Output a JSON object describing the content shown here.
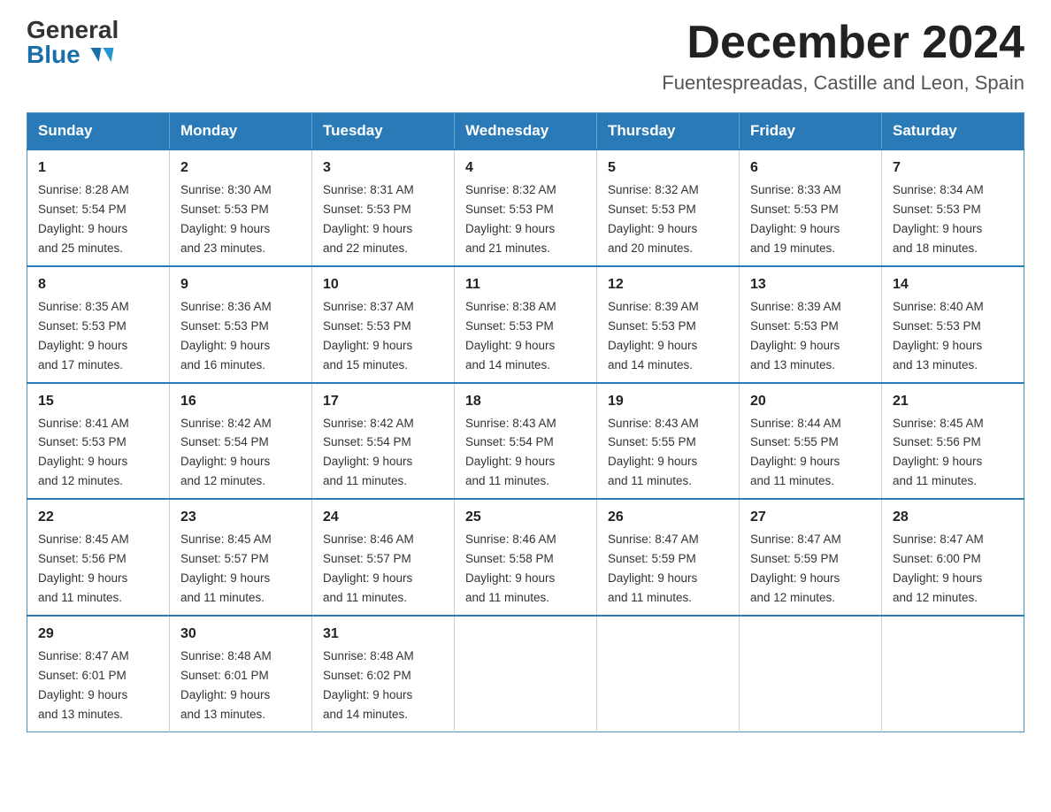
{
  "header": {
    "logo_general": "General",
    "logo_blue": "Blue",
    "month": "December 2024",
    "location": "Fuentespreadas, Castille and Leon, Spain"
  },
  "weekdays": [
    "Sunday",
    "Monday",
    "Tuesday",
    "Wednesday",
    "Thursday",
    "Friday",
    "Saturday"
  ],
  "weeks": [
    [
      {
        "day": "1",
        "sunrise": "8:28 AM",
        "sunset": "5:54 PM",
        "daylight": "9 hours and 25 minutes."
      },
      {
        "day": "2",
        "sunrise": "8:30 AM",
        "sunset": "5:53 PM",
        "daylight": "9 hours and 23 minutes."
      },
      {
        "day": "3",
        "sunrise": "8:31 AM",
        "sunset": "5:53 PM",
        "daylight": "9 hours and 22 minutes."
      },
      {
        "day": "4",
        "sunrise": "8:32 AM",
        "sunset": "5:53 PM",
        "daylight": "9 hours and 21 minutes."
      },
      {
        "day": "5",
        "sunrise": "8:32 AM",
        "sunset": "5:53 PM",
        "daylight": "9 hours and 20 minutes."
      },
      {
        "day": "6",
        "sunrise": "8:33 AM",
        "sunset": "5:53 PM",
        "daylight": "9 hours and 19 minutes."
      },
      {
        "day": "7",
        "sunrise": "8:34 AM",
        "sunset": "5:53 PM",
        "daylight": "9 hours and 18 minutes."
      }
    ],
    [
      {
        "day": "8",
        "sunrise": "8:35 AM",
        "sunset": "5:53 PM",
        "daylight": "9 hours and 17 minutes."
      },
      {
        "day": "9",
        "sunrise": "8:36 AM",
        "sunset": "5:53 PM",
        "daylight": "9 hours and 16 minutes."
      },
      {
        "day": "10",
        "sunrise": "8:37 AM",
        "sunset": "5:53 PM",
        "daylight": "9 hours and 15 minutes."
      },
      {
        "day": "11",
        "sunrise": "8:38 AM",
        "sunset": "5:53 PM",
        "daylight": "9 hours and 14 minutes."
      },
      {
        "day": "12",
        "sunrise": "8:39 AM",
        "sunset": "5:53 PM",
        "daylight": "9 hours and 14 minutes."
      },
      {
        "day": "13",
        "sunrise": "8:39 AM",
        "sunset": "5:53 PM",
        "daylight": "9 hours and 13 minutes."
      },
      {
        "day": "14",
        "sunrise": "8:40 AM",
        "sunset": "5:53 PM",
        "daylight": "9 hours and 13 minutes."
      }
    ],
    [
      {
        "day": "15",
        "sunrise": "8:41 AM",
        "sunset": "5:53 PM",
        "daylight": "9 hours and 12 minutes."
      },
      {
        "day": "16",
        "sunrise": "8:42 AM",
        "sunset": "5:54 PM",
        "daylight": "9 hours and 12 minutes."
      },
      {
        "day": "17",
        "sunrise": "8:42 AM",
        "sunset": "5:54 PM",
        "daylight": "9 hours and 11 minutes."
      },
      {
        "day": "18",
        "sunrise": "8:43 AM",
        "sunset": "5:54 PM",
        "daylight": "9 hours and 11 minutes."
      },
      {
        "day": "19",
        "sunrise": "8:43 AM",
        "sunset": "5:55 PM",
        "daylight": "9 hours and 11 minutes."
      },
      {
        "day": "20",
        "sunrise": "8:44 AM",
        "sunset": "5:55 PM",
        "daylight": "9 hours and 11 minutes."
      },
      {
        "day": "21",
        "sunrise": "8:45 AM",
        "sunset": "5:56 PM",
        "daylight": "9 hours and 11 minutes."
      }
    ],
    [
      {
        "day": "22",
        "sunrise": "8:45 AM",
        "sunset": "5:56 PM",
        "daylight": "9 hours and 11 minutes."
      },
      {
        "day": "23",
        "sunrise": "8:45 AM",
        "sunset": "5:57 PM",
        "daylight": "9 hours and 11 minutes."
      },
      {
        "day": "24",
        "sunrise": "8:46 AM",
        "sunset": "5:57 PM",
        "daylight": "9 hours and 11 minutes."
      },
      {
        "day": "25",
        "sunrise": "8:46 AM",
        "sunset": "5:58 PM",
        "daylight": "9 hours and 11 minutes."
      },
      {
        "day": "26",
        "sunrise": "8:47 AM",
        "sunset": "5:59 PM",
        "daylight": "9 hours and 11 minutes."
      },
      {
        "day": "27",
        "sunrise": "8:47 AM",
        "sunset": "5:59 PM",
        "daylight": "9 hours and 12 minutes."
      },
      {
        "day": "28",
        "sunrise": "8:47 AM",
        "sunset": "6:00 PM",
        "daylight": "9 hours and 12 minutes."
      }
    ],
    [
      {
        "day": "29",
        "sunrise": "8:47 AM",
        "sunset": "6:01 PM",
        "daylight": "9 hours and 13 minutes."
      },
      {
        "day": "30",
        "sunrise": "8:48 AM",
        "sunset": "6:01 PM",
        "daylight": "9 hours and 13 minutes."
      },
      {
        "day": "31",
        "sunrise": "8:48 AM",
        "sunset": "6:02 PM",
        "daylight": "9 hours and 14 minutes."
      },
      null,
      null,
      null,
      null
    ]
  ],
  "labels": {
    "sunrise": "Sunrise:",
    "sunset": "Sunset:",
    "daylight": "Daylight:"
  }
}
